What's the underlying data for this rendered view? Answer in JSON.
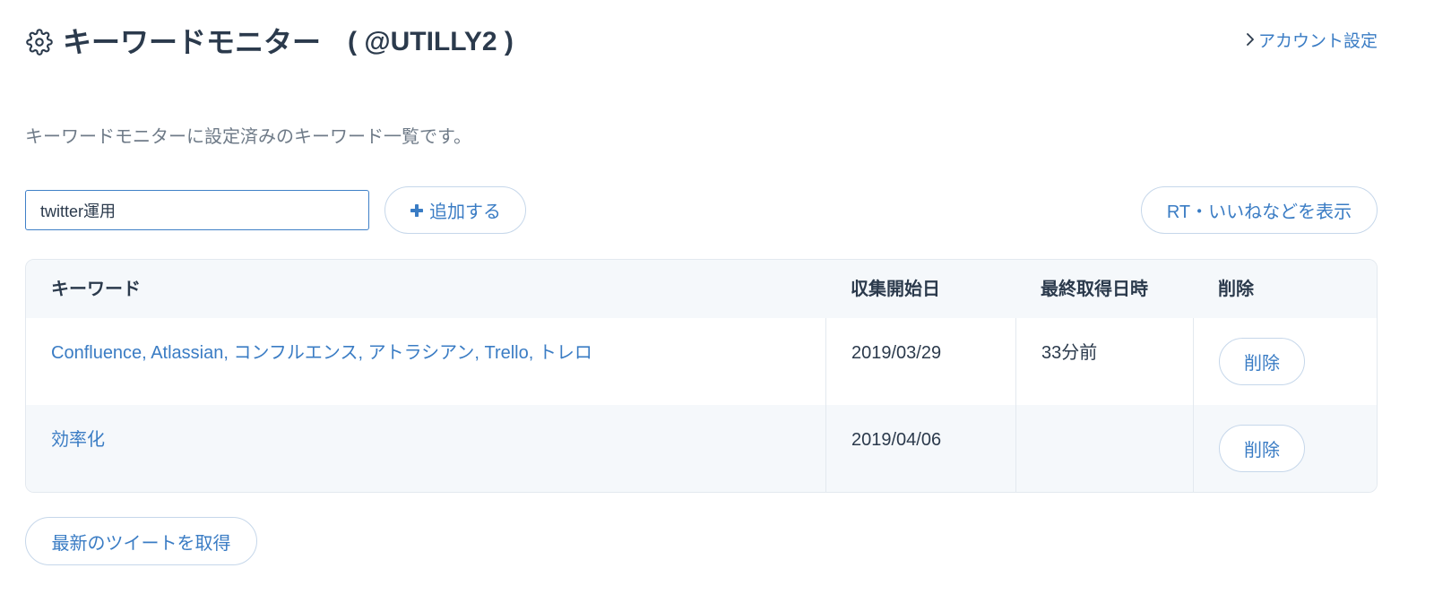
{
  "header": {
    "settings_icon": "gear-icon",
    "title": "キーワードモニター",
    "account": "( @UTILLY2 )",
    "account_settings_icon": "chevron-right-icon",
    "account_settings_label": "アカウント設定"
  },
  "description": "キーワードモニターに設定済みのキーワード一覧です。",
  "keyword_form": {
    "input_value": "twitter運用",
    "add_icon": "plus-icon",
    "add_label": "追加する"
  },
  "show_details_label": "RT・いいねなどを表示",
  "table": {
    "columns": [
      "キーワード",
      "収集開始日",
      "最終取得日時",
      "削除"
    ],
    "rows": [
      {
        "keywords": "Confluence, Atlassian, コンフルエンス, アトラシアン, Trello, トレロ",
        "start_date": "2019/03/29",
        "last_fetched": "33分前",
        "delete_label": "削除"
      },
      {
        "keywords": "効率化",
        "start_date": "2019/04/06",
        "last_fetched": "",
        "delete_label": "削除"
      }
    ]
  },
  "fetch_latest_label": "最新のツイートを取得",
  "colors": {
    "text": "#2b3a4c",
    "muted": "#6f7b88",
    "accent": "#3a7cc4",
    "btnborder": "#c6d7ea",
    "inputborder": "#3f80c7",
    "border": "#e3e9ef",
    "stripe": "#f5f8fb",
    "bg": "#ffffff"
  }
}
